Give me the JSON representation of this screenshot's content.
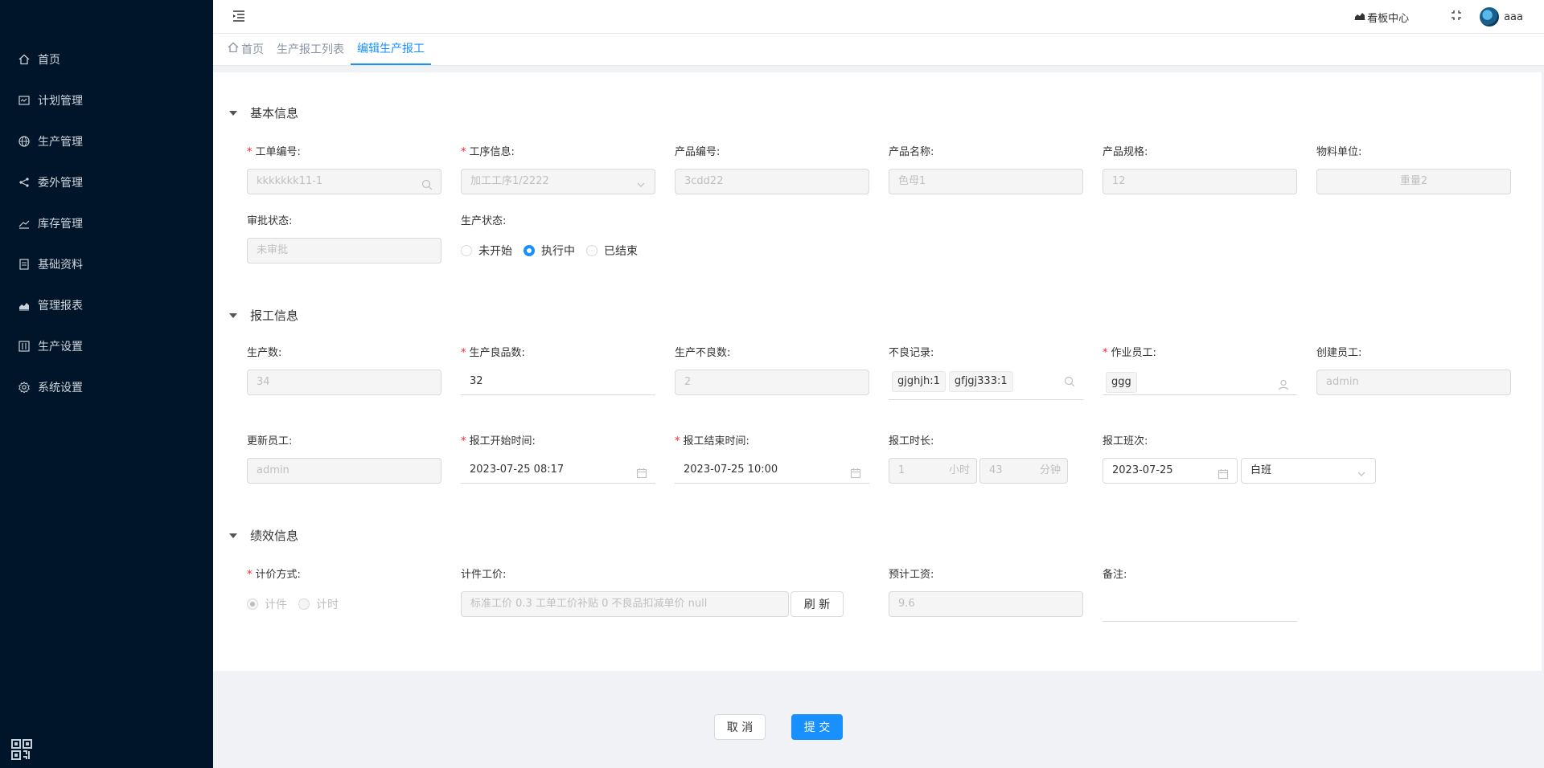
{
  "sidebar": {
    "items": [
      {
        "label": "首页",
        "icon": "home-icon"
      },
      {
        "label": "计划管理",
        "icon": "calendar-icon"
      },
      {
        "label": "生产管理",
        "icon": "globe-icon"
      },
      {
        "label": "委外管理",
        "icon": "share-icon"
      },
      {
        "label": "库存管理",
        "icon": "line-chart-icon"
      },
      {
        "label": "基础资料",
        "icon": "list-icon"
      },
      {
        "label": "管理报表",
        "icon": "area-chart-icon"
      },
      {
        "label": "生产设置",
        "icon": "settings-box-icon"
      },
      {
        "label": "系统设置",
        "icon": "gear-icon"
      }
    ]
  },
  "topbar": {
    "kanban_label": "看板中心",
    "username": "aaa"
  },
  "tabs": [
    {
      "label": "首页"
    },
    {
      "label": "生产报工列表"
    },
    {
      "label": "编辑生产报工"
    }
  ],
  "sections": {
    "basic": "基本信息",
    "report": "报工信息",
    "perf": "绩效信息"
  },
  "basic": {
    "order_no": {
      "label": "工单编号:",
      "value": "kkkkkkk11-1"
    },
    "process": {
      "label": "工序信息:",
      "value": "加工工序1/2222"
    },
    "product_no": {
      "label": "产品编号:",
      "value": "3cdd22"
    },
    "product_name": {
      "label": "产品名称:",
      "value": "色母1"
    },
    "product_spec": {
      "label": "产品规格:",
      "value": "12"
    },
    "unit": {
      "label": "物料单位:",
      "value": "重量2"
    },
    "approval": {
      "label": "审批状态:",
      "value": "未审批"
    },
    "prod_status": {
      "label": "生产状态:",
      "options": [
        "未开始",
        "执行中",
        "已结束"
      ],
      "selected": "执行中"
    }
  },
  "report": {
    "qty": {
      "label": "生产数:",
      "value": "34"
    },
    "good_qty": {
      "label": "生产良品数:",
      "value": "32"
    },
    "bad_qty": {
      "label": "生产不良数:",
      "value": "2"
    },
    "bad_record": {
      "label": "不良记录:",
      "tags": [
        "gjghjh:1",
        "gfjgj333:1"
      ]
    },
    "worker": {
      "label": "作业员工:",
      "value": "ggg"
    },
    "creator": {
      "label": "创建员工:",
      "value": "admin"
    },
    "updater": {
      "label": "更新员工:",
      "value": "admin"
    },
    "start_time": {
      "label": "报工开始时间:",
      "value": "2023-07-25 08:17"
    },
    "end_time": {
      "label": "报工结束时间:",
      "value": "2023-07-25 10:00"
    },
    "duration": {
      "label": "报工时长:",
      "hours": "1",
      "hours_unit": "小时",
      "minutes": "43",
      "minutes_unit": "分钟"
    },
    "shift": {
      "label": "报工班次:",
      "date": "2023-07-25",
      "shift": "白班"
    }
  },
  "perf": {
    "pricing": {
      "label": "计价方式:",
      "options": [
        "计件",
        "计时"
      ],
      "selected": "计件"
    },
    "unit_price": {
      "label": "计件工价:",
      "value": "标准工价 0.3   工单工价补贴 0   不良品扣减单价 null",
      "refresh": "刷 新"
    },
    "wage": {
      "label": "预计工资:",
      "value": "9.6"
    },
    "remark": {
      "label": "备注:",
      "value": ""
    }
  },
  "footer": {
    "cancel": "取 消",
    "submit": "提 交"
  },
  "colors": {
    "sidebar_bg": "#001529",
    "primary": "#1890ff",
    "required": "#f5222d"
  }
}
